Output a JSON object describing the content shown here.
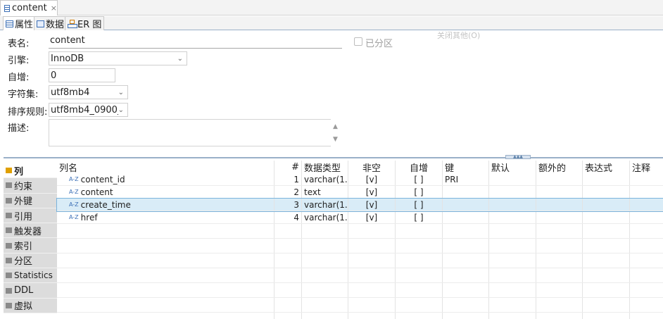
{
  "editor_tab": {
    "icon": "table-icon",
    "title": "content",
    "close": "×"
  },
  "view_tabs": [
    {
      "label": "属性",
      "icon": "table-icon"
    },
    {
      "label": "数据",
      "icon": "data-icon"
    },
    {
      "label": "ER 图",
      "icon": "er-diagram-icon"
    }
  ],
  "form": {
    "table_name_label": "表名:",
    "table_name": "content",
    "partitioned_label": "已分区",
    "close_others": "关闭其他(O)",
    "engine_label": "引擎:",
    "engine": "InnoDB",
    "auto_increment_label": "自增:",
    "auto_increment": "0",
    "charset_label": "字符集:",
    "charset": "utf8mb4",
    "collation_label": "排序规则:",
    "collation": "utf8mb4_0900_",
    "description_label": "描述:",
    "description": ""
  },
  "side_tabs": [
    "列",
    "约束",
    "外键",
    "引用",
    "触发器",
    "索引",
    "分区",
    "Statistics",
    "DDL",
    "虚拟"
  ],
  "columns_table": {
    "headers": [
      "列名",
      "#",
      "数据类型",
      "非空",
      "自增",
      "键",
      "默认",
      "额外的",
      "表达式",
      "注释"
    ],
    "rows": [
      {
        "name": "content_id",
        "num": "1",
        "type": "varchar(1...",
        "not_null": "[v]",
        "auto_inc": "[ ]",
        "key": "PRI"
      },
      {
        "name": "content",
        "num": "2",
        "type": "text",
        "not_null": "[v]",
        "auto_inc": "[ ]",
        "key": ""
      },
      {
        "name": "create_time",
        "num": "3",
        "type": "varchar(1...",
        "not_null": "[v]",
        "auto_inc": "[ ]",
        "key": ""
      },
      {
        "name": "href",
        "num": "4",
        "type": "varchar(1...",
        "not_null": "[v]",
        "auto_inc": "[ ]",
        "key": ""
      }
    ],
    "selected_row": 3,
    "type_icon": "A-Z"
  },
  "colors": {
    "accent": "#3b6fb6",
    "selection": "#d9ecf7",
    "sash": "#9ab0c8"
  }
}
